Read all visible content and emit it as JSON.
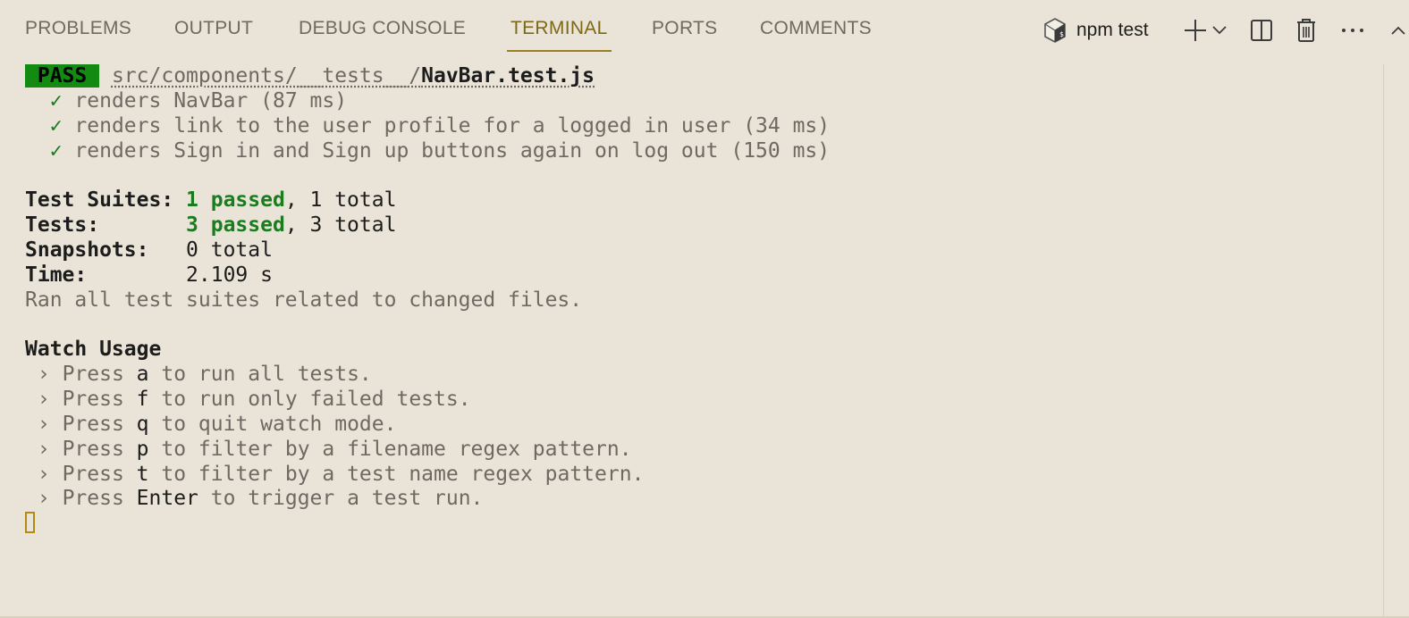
{
  "tabs": [
    {
      "label": "PROBLEMS",
      "active": false
    },
    {
      "label": "OUTPUT",
      "active": false
    },
    {
      "label": "DEBUG CONSOLE",
      "active": false
    },
    {
      "label": "TERMINAL",
      "active": true
    },
    {
      "label": "PORTS",
      "active": false
    },
    {
      "label": "COMMENTS",
      "active": false
    }
  ],
  "actions": {
    "terminal_name": "npm test",
    "terminal_icon": "terminal-shell-icon",
    "new_terminal_icon": "plus-icon",
    "dropdown_icon": "chevron-down-icon",
    "split_icon": "split-panel-icon",
    "kill_icon": "trash-icon",
    "more_icon": "ellipsis-icon",
    "maximize_icon": "chevron-up-icon"
  },
  "terminal": {
    "pass_badge": " PASS ",
    "path_dir": "src/components/__tests__/",
    "path_file": "NavBar.test.js",
    "check": "✓",
    "tests": [
      {
        "name": "renders NavBar",
        "duration": "(87 ms)"
      },
      {
        "name": "renders link to the user profile for a logged in user",
        "duration": "(34 ms)"
      },
      {
        "name": "renders Sign in and Sign up buttons again on log out",
        "duration": "(150 ms)"
      }
    ],
    "summary": {
      "suites_label": "Test Suites:",
      "suites_passed": "1 passed",
      "suites_total": ", 1 total",
      "tests_label": "Tests:",
      "tests_passed": "3 passed",
      "tests_total": ", 3 total",
      "snapshots_label": "Snapshots:",
      "snapshots_value": "0 total",
      "time_label": "Time:",
      "time_value": "2.109 s",
      "ran_note": "Ran all test suites related to changed files."
    },
    "watch": {
      "heading": "Watch Usage",
      "arrow": "›",
      "items": [
        {
          "pre": "Press ",
          "key": "a",
          "post": " to run all tests."
        },
        {
          "pre": "Press ",
          "key": "f",
          "post": " to run only failed tests."
        },
        {
          "pre": "Press ",
          "key": "q",
          "post": " to quit watch mode."
        },
        {
          "pre": "Press ",
          "key": "p",
          "post": " to filter by a filename regex pattern."
        },
        {
          "pre": "Press ",
          "key": "t",
          "post": " to filter by a test name regex pattern."
        },
        {
          "pre": "Press ",
          "key": "Enter",
          "post": " to trigger a test run."
        }
      ]
    }
  },
  "colors": {
    "background": "#e9e4d7",
    "active_tab": "#7d6816",
    "pass_badge": "#138a12",
    "passed_text": "#1b7b1f",
    "cursor": "#b38a16"
  }
}
